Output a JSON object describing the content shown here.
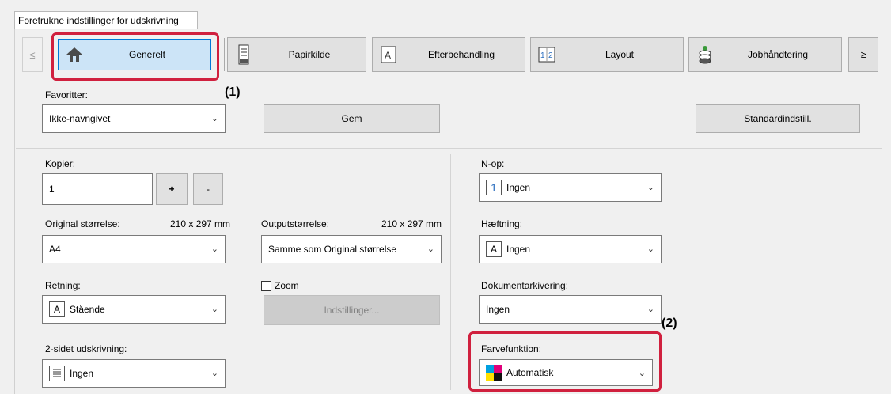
{
  "tab_header": "Foretrukne indstillinger for udskrivning",
  "nav": {
    "prev_arrow": "≤",
    "next_arrow": "≥",
    "tabs": [
      {
        "label": "Generelt",
        "icon": "home-icon"
      },
      {
        "label": "Papirkilde",
        "icon": "paper-source-icon"
      },
      {
        "label": "Efterbehandling",
        "icon": "finishing-icon"
      },
      {
        "label": "Layout",
        "icon": "layout-icon"
      },
      {
        "label": "Jobhåndtering",
        "icon": "job-handling-icon"
      }
    ]
  },
  "annotations": {
    "one": "(1)",
    "two": "(2)"
  },
  "favorites": {
    "label": "Favoritter:",
    "value": "Ikke-navngivet",
    "save_button": "Gem",
    "default_button": "Standardindstill."
  },
  "copies": {
    "label": "Kopier:",
    "value": "1",
    "plus": "+",
    "minus": "-"
  },
  "original_size": {
    "label": "Original størrelse:",
    "dims": "210 x 297 mm",
    "value": "A4"
  },
  "output_size": {
    "label": "Outputstørrelse:",
    "dims": "210 x 297 mm",
    "value": "Samme som Original størrelse"
  },
  "orientation": {
    "label": "Retning:",
    "value": "Stående"
  },
  "zoom": {
    "label": "Zoom",
    "checked": false,
    "settings_button": "Indstillinger..."
  },
  "duplex": {
    "label": "2-sidet udskrivning:",
    "value": "Ingen"
  },
  "n_up": {
    "label": "N-op:",
    "value": "Ingen",
    "glyph": "1"
  },
  "stapling": {
    "label": "Hæftning:",
    "value": "Ingen"
  },
  "doc_filing": {
    "label": "Dokumentarkivering:",
    "value": "Ingen"
  },
  "color_mode": {
    "label": "Farvefunktion:",
    "value": "Automatisk"
  },
  "colors": {
    "accent_red": "#d0203e",
    "selected_blue": "#cce4f7"
  }
}
